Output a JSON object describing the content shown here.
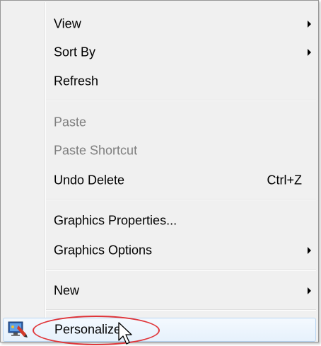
{
  "context_menu": {
    "items": [
      {
        "label": "View",
        "has_submenu": true
      },
      {
        "label": "Sort By",
        "has_submenu": true
      },
      {
        "label": "Refresh"
      },
      {
        "label": "Paste",
        "disabled": true
      },
      {
        "label": "Paste Shortcut",
        "disabled": true
      },
      {
        "label": "Undo Delete",
        "shortcut": "Ctrl+Z"
      },
      {
        "label": "Graphics Properties..."
      },
      {
        "label": "Graphics Options",
        "has_submenu": true
      },
      {
        "label": "New",
        "has_submenu": true
      },
      {
        "label": "Personalize",
        "highlighted": true,
        "icon": "personalize-icon"
      }
    ]
  },
  "annotation": {
    "ellipse_color": "#e0363a",
    "target": "Personalize"
  }
}
